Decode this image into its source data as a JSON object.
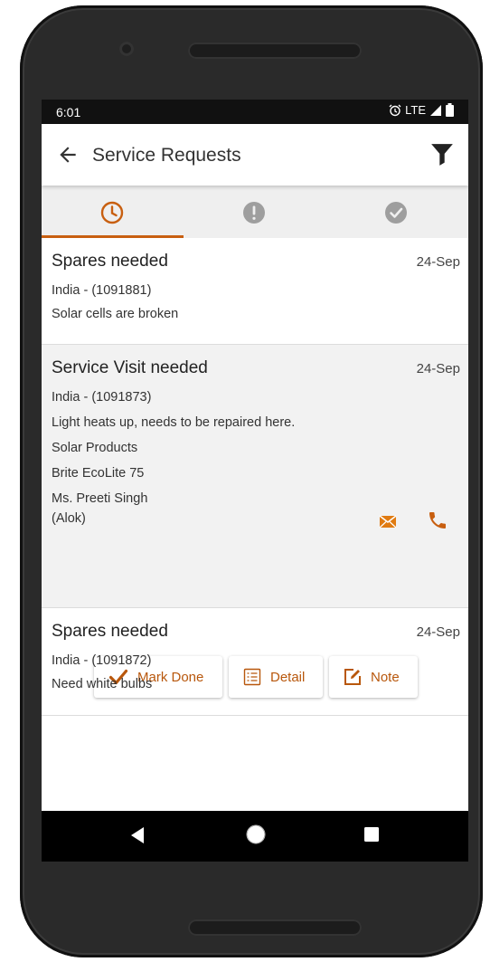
{
  "status_bar": {
    "time": "6:01",
    "network": "LTE",
    "icons": [
      "alarm-icon",
      "signal-icon",
      "battery-icon"
    ]
  },
  "app_bar": {
    "title": "Service Requests",
    "icons": [
      "back-arrow-icon",
      "filter-funnel-icon"
    ]
  },
  "tabs": [
    {
      "icon": "clock-icon",
      "selected": true
    },
    {
      "icon": "exclamation-circle-icon",
      "selected": false
    },
    {
      "icon": "check-circle-icon",
      "selected": false
    }
  ],
  "requests": [
    {
      "title": "Spares needed",
      "date": "24-Sep",
      "location": "India - (1091881)",
      "description": "Solar cells are broken"
    },
    {
      "title": "Service Visit needed",
      "date": "24-Sep",
      "location": "India - (1091873)",
      "description": "Light heats up, needs to be repaired here.",
      "category": "Solar Products",
      "product": "Brite EcoLite 75",
      "contact": "Ms. Preeti Singh",
      "agent": "(Alok)",
      "actions": {
        "mark_done": "Mark Done",
        "detail": "Detail",
        "note": "Note"
      }
    },
    {
      "title": "Spares needed",
      "date": "24-Sep",
      "location": "India - (1091872)",
      "description": "Need white bulbs"
    }
  ],
  "colors": {
    "accent": "#c85f10",
    "tab_bar": "#efefef",
    "expanded_card": "#f2f2f2"
  }
}
